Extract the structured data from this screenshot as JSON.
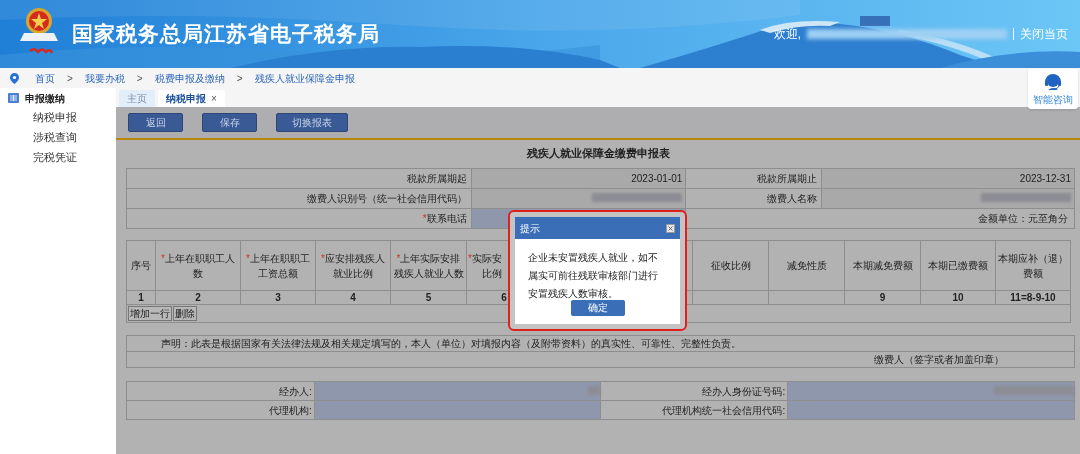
{
  "header": {
    "title": "国家税务总局江苏省电子税务局",
    "welcome": "欢迎,",
    "close_link": "关闭当页"
  },
  "breadcrumb": [
    {
      "label": "首页"
    },
    {
      "separator": ">",
      "label": "我要办税"
    },
    {
      "separator": ">",
      "label": "税费申报及缴纳"
    },
    {
      "separator": ">",
      "label": "残疾人就业保障金申报"
    }
  ],
  "assistant": {
    "label": "智能咨询"
  },
  "sidebar": {
    "section": "申报缴纳",
    "items": [
      "纳税申报",
      "涉税查询",
      "完税凭证"
    ]
  },
  "tabs": [
    {
      "label": "主页",
      "selected": false
    },
    {
      "label": "纳税申报",
      "selected": true,
      "close": "×"
    }
  ],
  "toolbar": [
    "返回",
    "保存",
    "切换报表"
  ],
  "form": {
    "title": "残疾人就业保障金缴费申报表",
    "info_rows": [
      [
        {
          "kind": "label",
          "text": "税款所属期起"
        },
        {
          "kind": "value",
          "text": "2023-01-01"
        },
        {
          "kind": "label",
          "text": "税款所属期止"
        },
        {
          "kind": "value",
          "text": "2023-12-31"
        }
      ],
      [
        {
          "kind": "label",
          "text": "缴费人识别号（统一社会信用代码）"
        },
        {
          "kind": "redacted"
        },
        {
          "kind": "label",
          "text": "缴费人名称"
        },
        {
          "kind": "redacted"
        }
      ],
      [
        {
          "kind": "label",
          "mark": "*",
          "text": "联系电话"
        },
        {
          "kind": "input"
        },
        {
          "kind": "note",
          "text": "金额单位：元至角分"
        }
      ]
    ],
    "columns": [
      {
        "label": "序号",
        "number": "1"
      },
      {
        "mark": "*",
        "label": "上年在职职工人数",
        "number": "2"
      },
      {
        "mark": "*",
        "label": "上年在职职工工资总额",
        "number": "3"
      },
      {
        "mark": "*",
        "label": "应安排残疾人就业比例",
        "number": "4"
      },
      {
        "mark": "*",
        "label": "上年实际安排残疾人就业人数",
        "number": "5"
      },
      {
        "mark": "*",
        "label": "实际安",
        "label_2": "比例",
        "number": "6"
      },
      {},
      {},
      {
        "label": "征收比例"
      },
      {
        "label": "减免性质"
      },
      {
        "label": "本期减免费额",
        "number": "9"
      },
      {
        "label": "本期已缴费额",
        "number": "10"
      },
      {
        "label": "本期应补（退）费额",
        "number": "11=8-9-10"
      }
    ],
    "row_buttons": [
      "增加一行",
      "删除"
    ],
    "declaration": "声明：此表是根据国家有关法律法规及相关规定填写的，本人（单位）对填报内容（及附带资料）的真实性、可靠性、完整性负责。",
    "signature": "缴费人（签字或者加盖印章）",
    "agent_rows": [
      [
        "经办人:",
        "经办人身份证号码:"
      ],
      [
        "代理机构:",
        "代理机构统一社会信用代码:"
      ]
    ]
  },
  "dialog": {
    "title": "提示",
    "message": "企业未安置残疾人就业，如不属实可前往残联审核部门进行安置残疾人数审核。",
    "button": "确定"
  }
}
